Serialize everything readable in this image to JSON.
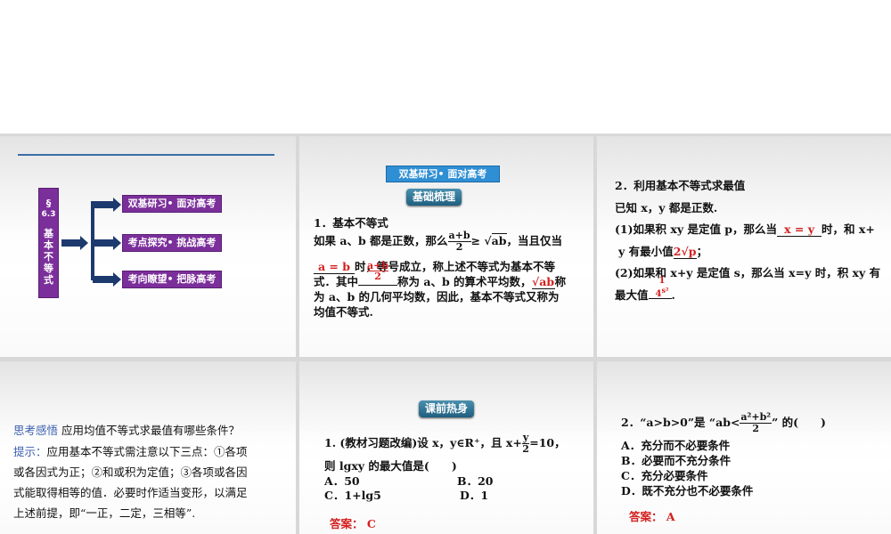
{
  "slide1": {
    "section": "§",
    "number": "6.3",
    "title_chars": [
      "基",
      "本",
      "不",
      "等",
      "式"
    ],
    "branches": [
      "双基研习• 面对高考",
      "考点探究• 挑战高考",
      "考向瞭望• 把脉高考"
    ]
  },
  "slide2": {
    "header": "双基研习• 面对高考",
    "pill": "基础梳理",
    "heading": "1．基本不等式",
    "l1a": "如果 a、b 都是正数，那么",
    "frac_num": "a+b",
    "frac_den": "2",
    "l1b": "≥",
    "sqrt": "ab",
    "l1c": "，当且仅当",
    "blank1": "a = b",
    "l2": "时，等号成立，称上述不等式为基本不等",
    "l3a": "式．其中",
    "blank2_num": "a+b",
    "blank2_den": "2",
    "l3b": "称为 a、b 的算术平均数，",
    "blank3": "ab",
    "l3c": "称",
    "l4": "为 a、b 的几何平均数，因此，基本不等式又称为",
    "l5": "均值不等式."
  },
  "slide3": {
    "heading": "2．利用基本不等式求最值",
    "l1": "已知 x，y 都是正数.",
    "l2a": "(1)如果积 xy 是定值 p，那么当",
    "blank1": "x = y",
    "l2b": "时，和 x+",
    "l3a": "y 有最小值",
    "blank2": "2√p",
    "l3b": "；",
    "l4": "(2)如果和 x+y 是定值 s，那么当 x=y 时，积 xy 有",
    "l5a": "最大值",
    "blank3_num": "1",
    "blank3_den": "4",
    "blank3_sup": "s²",
    "l5b": "."
  },
  "slide4": {
    "label": "思考感悟",
    "question": "应用均值不等式求最值有哪些条件？",
    "hint_label": "提示：",
    "lines": [
      "应用基本不等式需注意以下三点：①各项",
      "或各因式为正；②和或积为定值；③各项或各因",
      "式能取得相等的值．必要时作适当变形，以满足",
      "上述前提，即“一正，二定，三相等”."
    ]
  },
  "slide5": {
    "pill": "课前热身",
    "q1a": "1. (教材习题改编)设 x，y∈R⁺，且 x+",
    "q1_num": "y",
    "q1_den": "2",
    "q1b": "=10，",
    "q2": "则 lgxy 的最大值是(　　)",
    "options": [
      "A．50",
      "B．20",
      "C．1+lg5",
      "D．1"
    ],
    "answer": "答案： C"
  },
  "slide6": {
    "qa": "2．“a>b>0”是 “ab<",
    "q_num": "a²+b²",
    "q_den": "2",
    "qb": "” 的(　　)",
    "options": [
      "A．充分而不必要条件",
      "B．必要而不充分条件",
      "C．充分必要条件",
      "D．既不充分也不必要条件"
    ],
    "answer": "答案： A"
  }
}
